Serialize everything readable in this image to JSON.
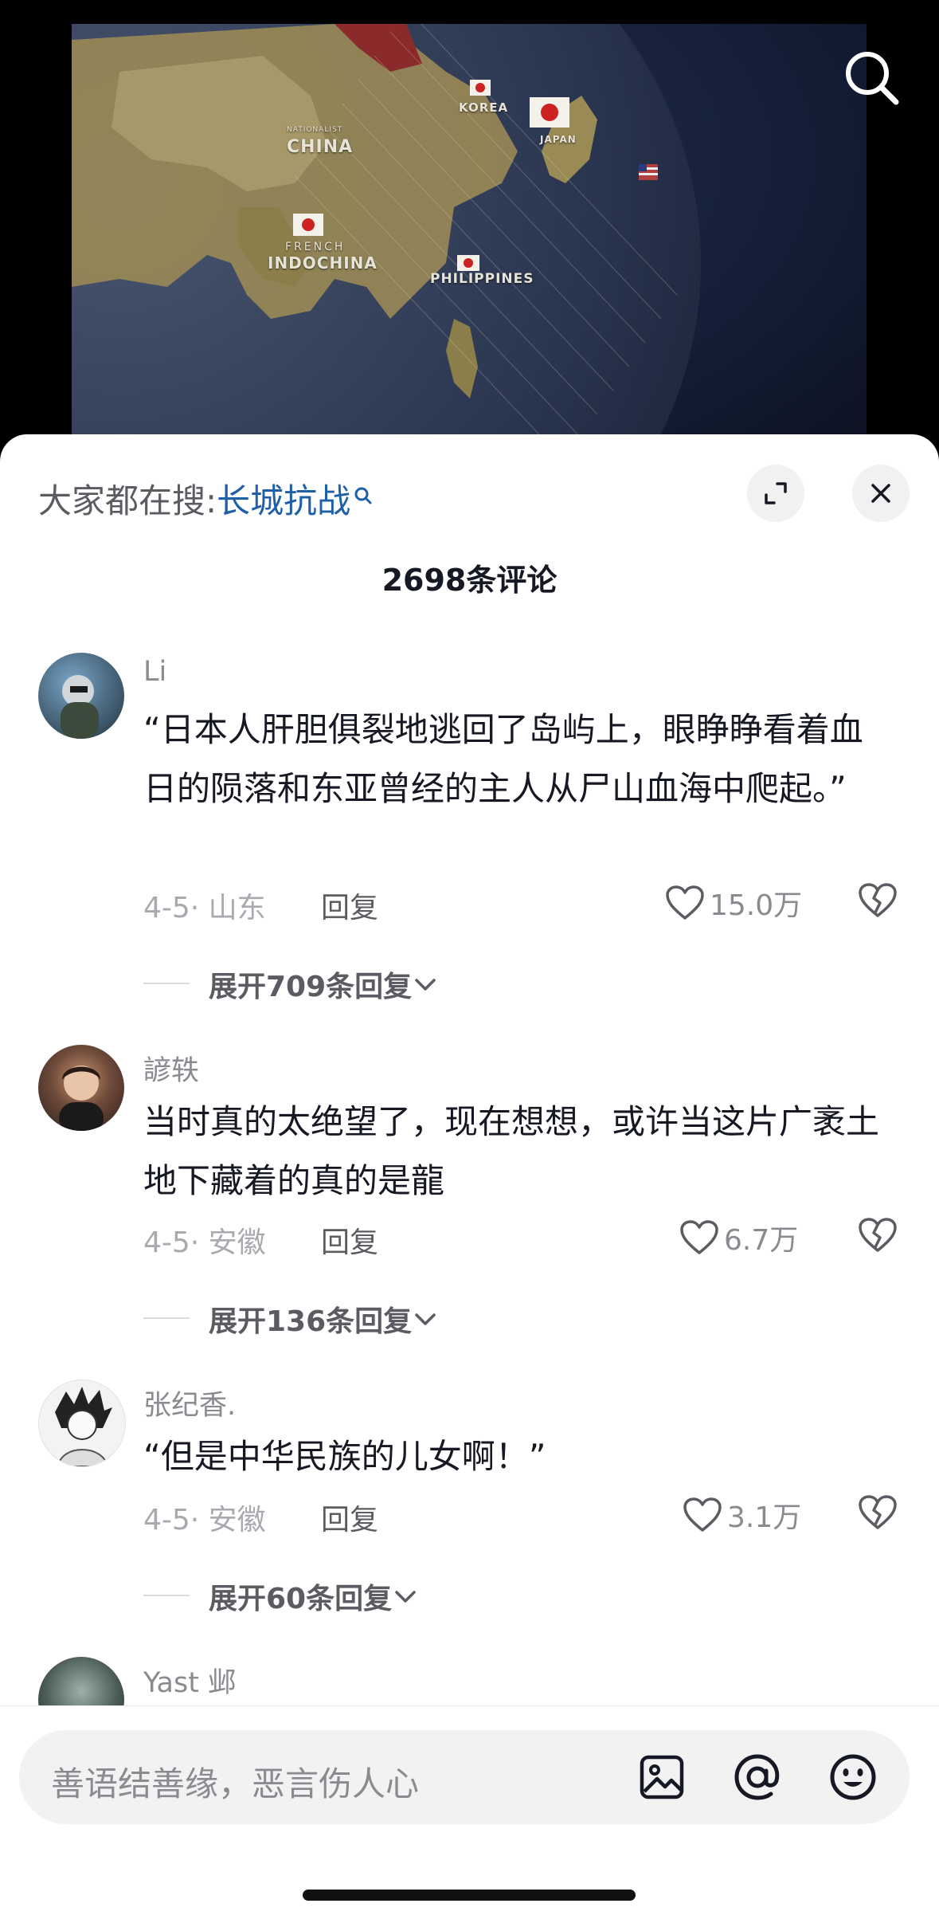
{
  "video": {
    "map_labels": {
      "korea": "KOREA",
      "japan": "JAPAN",
      "nationalist": "NATIONALIST",
      "china": "CHINA",
      "french": "FRENCH",
      "indochina": "INDOCHINA",
      "philippines": "PHILIPPINES"
    }
  },
  "panel": {
    "hot_search_prefix": "大家都在搜:",
    "hot_search_keyword": "长城抗战",
    "comment_count": "2698条评论"
  },
  "comments": [
    {
      "name": "Li",
      "text": "“日本人肝胆俱裂地逃回了岛屿上，眼睁睁看着血日的陨落和东亚曾经的主人从尸山血海中爬起。”",
      "meta": "4-5· 山东",
      "reply": "回复",
      "likes": "15.0万",
      "expand": "展开709条回复"
    },
    {
      "name": "諺轶",
      "text": "当时真的太绝望了，现在想想，或许当这片广袤土地下藏着的真的是龍",
      "meta": "4-5· 安徽",
      "reply": "回复",
      "likes": "6.7万",
      "expand": "展开136条回复"
    },
    {
      "name": "张纪香.",
      "text": "“但是中华民族的儿女啊！”",
      "meta": "4-5· 安徽",
      "reply": "回复",
      "likes": "3.1万",
      "expand": "展开60条回复"
    },
    {
      "name": "Yast 邺"
    }
  ],
  "input": {
    "placeholder": "善语结善缘，恶言伤人心"
  },
  "icons": {
    "search": "search-icon",
    "expand": "fullscreen-icon",
    "close": "close-icon",
    "like": "heart-icon",
    "dislike": "broken-heart-icon",
    "image": "image-icon",
    "mention": "at-icon",
    "emoji": "emoji-icon"
  },
  "colors": {
    "keyword": "#1f5fa8",
    "text": "#161823",
    "muted": "#8a8b91"
  }
}
